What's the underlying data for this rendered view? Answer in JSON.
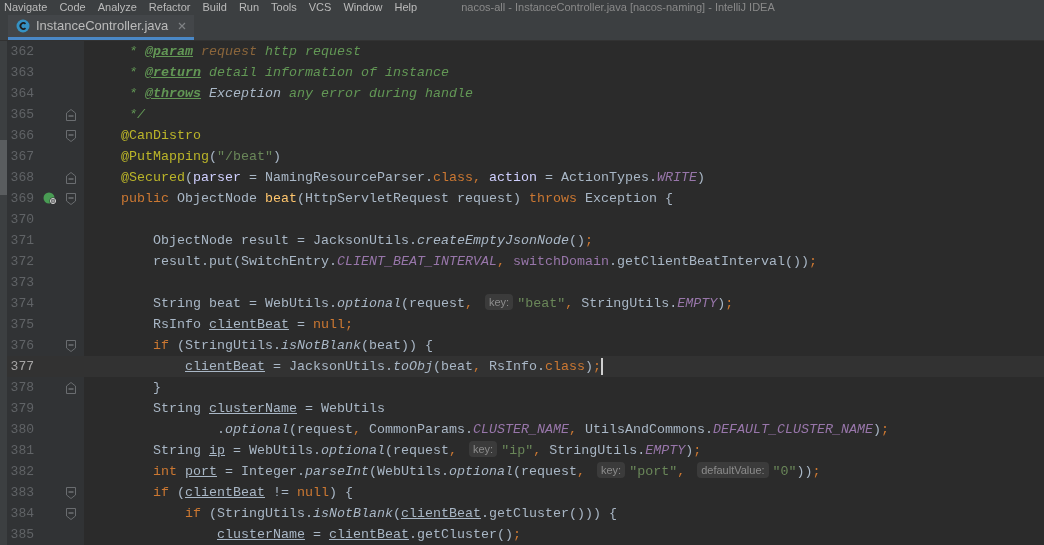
{
  "menu": {
    "items": [
      "Navigate",
      "Code",
      "Analyze",
      "Refactor",
      "Build",
      "Run",
      "Tools",
      "VCS",
      "Window",
      "Help"
    ],
    "title": "nacos-all - InstanceController.java [nacos-naming] - IntelliJ IDEA"
  },
  "tabs": [
    {
      "label": "InstanceController.java",
      "selected": true
    }
  ],
  "editor": {
    "lines": [
      {
        "number": "362",
        "fold_start": false,
        "fold_end": false,
        "gutter_icon": false,
        "current": false,
        "tokens": [
          {
            "kind": "doc",
            "text": " * "
          },
          {
            "kind": "doctag",
            "text": "@param"
          },
          {
            "kind": "docparam",
            "text": " request"
          },
          {
            "kind": "doc",
            "text": " http request"
          }
        ]
      },
      {
        "number": "363",
        "fold_start": false,
        "fold_end": false,
        "gutter_icon": false,
        "current": false,
        "tokens": [
          {
            "kind": "doc",
            "text": " * "
          },
          {
            "kind": "doctag",
            "text": "@return"
          },
          {
            "kind": "doc",
            "text": " detail information of instance"
          }
        ]
      },
      {
        "number": "364",
        "fold_start": false,
        "fold_end": false,
        "gutter_icon": false,
        "current": false,
        "tokens": [
          {
            "kind": "doc",
            "text": " * "
          },
          {
            "kind": "doctag",
            "text": "@throws"
          },
          {
            "kind": "docref",
            "text": " Exception"
          },
          {
            "kind": "doc",
            "text": " any error during handle"
          }
        ]
      },
      {
        "number": "365",
        "fold_start": false,
        "fold_end": true,
        "gutter_icon": false,
        "current": false,
        "tokens": [
          {
            "kind": "doc",
            "text": " */"
          }
        ]
      },
      {
        "number": "366",
        "fold_start": true,
        "fold_end": false,
        "gutter_icon": false,
        "current": false,
        "tokens": [
          {
            "kind": "annotation",
            "text": "@CanDistro"
          }
        ]
      },
      {
        "number": "367",
        "fold_start": false,
        "fold_end": false,
        "gutter_icon": false,
        "current": false,
        "tokens": [
          {
            "kind": "annotation",
            "text": "@PutMapping"
          },
          {
            "kind": "plain",
            "text": "("
          },
          {
            "kind": "string",
            "text": "\"/beat\""
          },
          {
            "kind": "plain",
            "text": ")"
          }
        ]
      },
      {
        "number": "368",
        "fold_start": false,
        "fold_end": true,
        "gutter_icon": false,
        "current": false,
        "tokens": [
          {
            "kind": "annotation",
            "text": "@Secured"
          },
          {
            "kind": "plain",
            "text": "("
          },
          {
            "kind": "attr",
            "text": "parser"
          },
          {
            "kind": "plain",
            "text": " = NamingResourceParser."
          },
          {
            "kind": "keyword",
            "text": "class, "
          },
          {
            "kind": "attr",
            "text": "action"
          },
          {
            "kind": "plain",
            "text": " = ActionTypes."
          },
          {
            "kind": "static",
            "text": "WRITE"
          },
          {
            "kind": "plain",
            "text": ")"
          }
        ]
      },
      {
        "number": "369",
        "fold_start": true,
        "fold_end": false,
        "gutter_icon": true,
        "current": false,
        "tokens": [
          {
            "kind": "keyword",
            "text": "public "
          },
          {
            "kind": "plain",
            "text": "ObjectNode "
          },
          {
            "kind": "method",
            "text": "beat"
          },
          {
            "kind": "plain",
            "text": "(HttpServletRequest request) "
          },
          {
            "kind": "keyword",
            "text": "throws "
          },
          {
            "kind": "plain",
            "text": "Exception {"
          }
        ]
      },
      {
        "number": "370",
        "fold_start": false,
        "fold_end": false,
        "gutter_icon": false,
        "current": false
      },
      {
        "number": "371",
        "fold_start": false,
        "fold_end": false,
        "gutter_icon": false,
        "current": false,
        "tokens": [
          {
            "kind": "plain",
            "text": "    ObjectNode result = JacksonUtils."
          },
          {
            "kind": "call",
            "text": "createEmptyJsonNode"
          },
          {
            "kind": "plain",
            "text": "()"
          },
          {
            "kind": "keyword",
            "text": ";"
          }
        ]
      },
      {
        "number": "372",
        "fold_start": false,
        "fold_end": false,
        "gutter_icon": false,
        "current": false,
        "tokens": [
          {
            "kind": "plain",
            "text": "    result.put(SwitchEntry."
          },
          {
            "kind": "static",
            "text": "CLIENT_BEAT_INTERVAL"
          },
          {
            "kind": "keyword",
            "text": ", "
          },
          {
            "kind": "field",
            "text": "switchDomain"
          },
          {
            "kind": "plain",
            "text": ".getClientBeatInterval())"
          },
          {
            "kind": "keyword",
            "text": ";"
          }
        ]
      },
      {
        "number": "373",
        "fold_start": false,
        "fold_end": false,
        "gutter_icon": false,
        "current": false
      },
      {
        "number": "374",
        "fold_start": false,
        "fold_end": false,
        "gutter_icon": false,
        "current": false,
        "tokens": [
          {
            "kind": "plain",
            "text": "    String beat = WebUtils."
          },
          {
            "kind": "call",
            "text": "optional"
          },
          {
            "kind": "plain",
            "text": "(request"
          },
          {
            "kind": "keyword",
            "text": ", "
          },
          {
            "kind": "hint",
            "text": "key:"
          },
          {
            "kind": "string",
            "text": "\"beat\""
          },
          {
            "kind": "keyword",
            "text": ", "
          },
          {
            "kind": "plain",
            "text": "StringUtils."
          },
          {
            "kind": "static",
            "text": "EMPTY"
          },
          {
            "kind": "plain",
            "text": ")"
          },
          {
            "kind": "keyword",
            "text": ";"
          }
        ]
      },
      {
        "number": "375",
        "fold_start": false,
        "fold_end": false,
        "gutter_icon": false,
        "current": false,
        "tokens": [
          {
            "kind": "plain",
            "text": "    RsInfo "
          },
          {
            "kind": "reassigned",
            "text": "clientBeat"
          },
          {
            "kind": "plain",
            "text": " = "
          },
          {
            "kind": "keyword",
            "text": "null;"
          }
        ]
      },
      {
        "number": "376",
        "fold_start": true,
        "fold_end": false,
        "gutter_icon": false,
        "current": false,
        "tokens": [
          {
            "kind": "keyword",
            "text": "    if "
          },
          {
            "kind": "plain",
            "text": "(StringUtils."
          },
          {
            "kind": "call",
            "text": "isNotBlank"
          },
          {
            "kind": "plain",
            "text": "(beat)) {"
          }
        ]
      },
      {
        "number": "377",
        "fold_start": false,
        "fold_end": false,
        "gutter_icon": false,
        "current": true,
        "tokens": [
          {
            "kind": "reassigned",
            "text": "        clientBeat"
          },
          {
            "kind": "plain",
            "text": " = JacksonUtils."
          },
          {
            "kind": "call",
            "text": "toObj"
          },
          {
            "kind": "plain",
            "text": "(beat"
          },
          {
            "kind": "keyword",
            "text": ", "
          },
          {
            "kind": "plain",
            "text": "RsInfo."
          },
          {
            "kind": "keyword",
            "text": "class"
          },
          {
            "kind": "plain",
            "text": ")"
          },
          {
            "kind": "keyword",
            "text": ";"
          }
        ]
      },
      {
        "number": "378",
        "fold_start": false,
        "fold_end": true,
        "gutter_icon": false,
        "current": false,
        "tokens": [
          {
            "kind": "plain",
            "text": "    }"
          }
        ]
      },
      {
        "number": "379",
        "fold_start": false,
        "fold_end": false,
        "gutter_icon": false,
        "current": false,
        "tokens": [
          {
            "kind": "plain",
            "text": "    String "
          },
          {
            "kind": "reassigned",
            "text": "clusterName"
          },
          {
            "kind": "plain",
            "text": " = WebUtils"
          }
        ]
      },
      {
        "number": "380",
        "fold_start": false,
        "fold_end": false,
        "gutter_icon": false,
        "current": false,
        "tokens": [
          {
            "kind": "plain",
            "text": "            ."
          },
          {
            "kind": "call",
            "text": "optional"
          },
          {
            "kind": "plain",
            "text": "(request"
          },
          {
            "kind": "keyword",
            "text": ", "
          },
          {
            "kind": "plain",
            "text": "CommonParams."
          },
          {
            "kind": "static",
            "text": "CLUSTER_NAME"
          },
          {
            "kind": "keyword",
            "text": ", "
          },
          {
            "kind": "plain",
            "text": "UtilsAndCommons."
          },
          {
            "kind": "static",
            "text": "DEFAULT_CLUSTER_NAME"
          },
          {
            "kind": "plain",
            "text": ")"
          },
          {
            "kind": "keyword",
            "text": ";"
          }
        ]
      },
      {
        "number": "381",
        "fold_start": false,
        "fold_end": false,
        "gutter_icon": false,
        "current": false,
        "tokens": [
          {
            "kind": "plain",
            "text": "    String "
          },
          {
            "kind": "reassigned",
            "text": "ip"
          },
          {
            "kind": "plain",
            "text": " = WebUtils."
          },
          {
            "kind": "call",
            "text": "optional"
          },
          {
            "kind": "plain",
            "text": "(request"
          },
          {
            "kind": "keyword",
            "text": ", "
          },
          {
            "kind": "hint",
            "text": "key:"
          },
          {
            "kind": "string",
            "text": "\"ip\""
          },
          {
            "kind": "keyword",
            "text": ", "
          },
          {
            "kind": "plain",
            "text": "StringUtils."
          },
          {
            "kind": "static",
            "text": "EMPTY"
          },
          {
            "kind": "plain",
            "text": ")"
          },
          {
            "kind": "keyword",
            "text": ";"
          }
        ]
      },
      {
        "number": "382",
        "fold_start": false,
        "fold_end": false,
        "gutter_icon": false,
        "current": false,
        "tokens": [
          {
            "kind": "keyword",
            "text": "    int "
          },
          {
            "kind": "reassigned",
            "text": "port"
          },
          {
            "kind": "plain",
            "text": " = Integer."
          },
          {
            "kind": "call",
            "text": "parseInt"
          },
          {
            "kind": "plain",
            "text": "(WebUtils."
          },
          {
            "kind": "call",
            "text": "optional"
          },
          {
            "kind": "plain",
            "text": "(request"
          },
          {
            "kind": "keyword",
            "text": ", "
          },
          {
            "kind": "hint",
            "text": "key:"
          },
          {
            "kind": "string",
            "text": "\"port\""
          },
          {
            "kind": "keyword",
            "text": ", "
          },
          {
            "kind": "hint",
            "text": "defaultValue:"
          },
          {
            "kind": "string",
            "text": "\"0\""
          },
          {
            "kind": "plain",
            "text": "))"
          },
          {
            "kind": "keyword",
            "text": ";"
          }
        ]
      },
      {
        "number": "383",
        "fold_start": true,
        "fold_end": false,
        "gutter_icon": false,
        "current": false,
        "tokens": [
          {
            "kind": "keyword",
            "text": "    if "
          },
          {
            "kind": "plain",
            "text": "("
          },
          {
            "kind": "reassigned",
            "text": "clientBeat"
          },
          {
            "kind": "plain",
            "text": " != "
          },
          {
            "kind": "keyword",
            "text": "null"
          },
          {
            "kind": "plain",
            "text": ") {"
          }
        ]
      },
      {
        "number": "384",
        "fold_start": true,
        "fold_end": false,
        "gutter_icon": false,
        "current": false,
        "tokens": [
          {
            "kind": "keyword",
            "text": "        if "
          },
          {
            "kind": "plain",
            "text": "(StringUtils."
          },
          {
            "kind": "call",
            "text": "isNotBlank"
          },
          {
            "kind": "plain",
            "text": "("
          },
          {
            "kind": "reassigned",
            "text": "clientBeat"
          },
          {
            "kind": "plain",
            "text": ".getCluster())) {"
          }
        ]
      },
      {
        "number": "385",
        "fold_start": false,
        "fold_end": false,
        "gutter_icon": false,
        "current": false,
        "tokens": [
          {
            "kind": "reassigned",
            "text": "            clusterName"
          },
          {
            "kind": "plain",
            "text": " = "
          },
          {
            "kind": "reassigned",
            "text": "clientBeat"
          },
          {
            "kind": "plain",
            "text": ".getCluster()"
          },
          {
            "kind": "keyword",
            "text": ";"
          }
        ]
      }
    ]
  }
}
